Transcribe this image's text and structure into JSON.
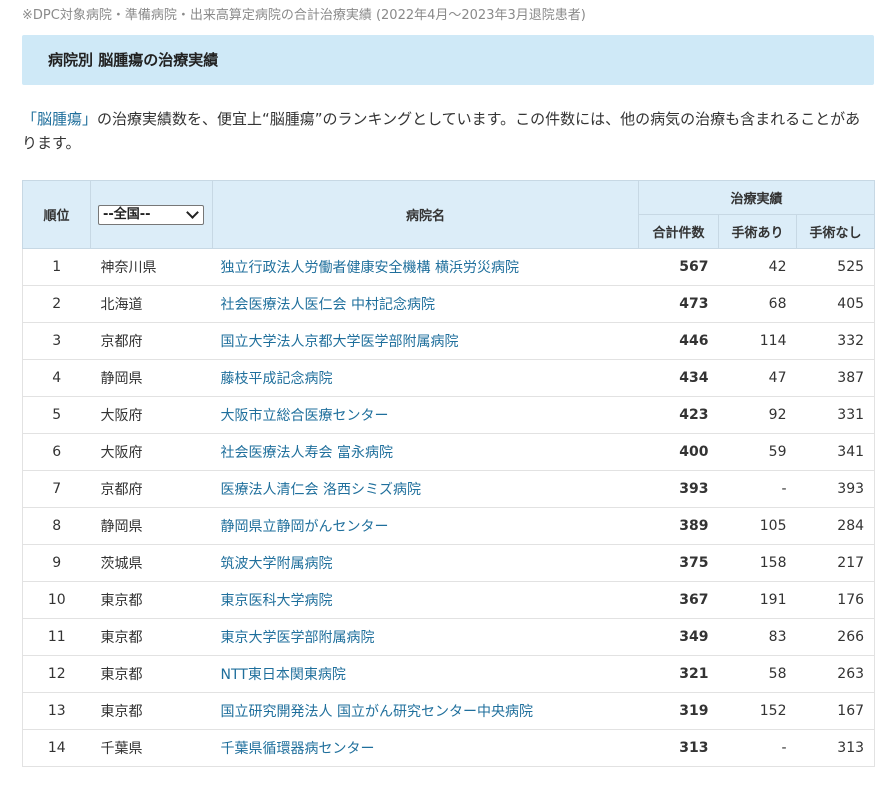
{
  "note": "※DPC対象病院・準備病院・出来高算定病院の合計治療実績 (2022年4月～2023年3月退院患者)",
  "banner": {
    "title": "病院別 脳腫瘍の治療実績"
  },
  "description": {
    "part1": "「脳腫瘍」",
    "part2": "の治療実績数を、便宜上“脳腫瘍”のランキングとしています。この件数には、他の病気の治療も含まれることがあります。"
  },
  "table": {
    "headers": {
      "rank": "順位",
      "region_select": "--全国--",
      "hospital": "病院名",
      "results": "治療実績",
      "total": "合計件数",
      "with_surgery": "手術あり",
      "without_surgery": "手術なし"
    },
    "rows": [
      {
        "rank": "1",
        "pref": "神奈川県",
        "name": "独立行政法人労働者健康安全機構 横浜労災病院",
        "total": "567",
        "with": "42",
        "without": "525"
      },
      {
        "rank": "2",
        "pref": "北海道",
        "name": "社会医療法人医仁会 中村記念病院",
        "total": "473",
        "with": "68",
        "without": "405"
      },
      {
        "rank": "3",
        "pref": "京都府",
        "name": "国立大学法人京都大学医学部附属病院",
        "total": "446",
        "with": "114",
        "without": "332"
      },
      {
        "rank": "4",
        "pref": "静岡県",
        "name": "藤枝平成記念病院",
        "total": "434",
        "with": "47",
        "without": "387"
      },
      {
        "rank": "5",
        "pref": "大阪府",
        "name": "大阪市立総合医療センター",
        "total": "423",
        "with": "92",
        "without": "331"
      },
      {
        "rank": "6",
        "pref": "大阪府",
        "name": "社会医療法人寿会 富永病院",
        "total": "400",
        "with": "59",
        "without": "341"
      },
      {
        "rank": "7",
        "pref": "京都府",
        "name": "医療法人清仁会 洛西シミズ病院",
        "total": "393",
        "with": "-",
        "without": "393"
      },
      {
        "rank": "8",
        "pref": "静岡県",
        "name": "静岡県立静岡がんセンター",
        "total": "389",
        "with": "105",
        "without": "284"
      },
      {
        "rank": "9",
        "pref": "茨城県",
        "name": "筑波大学附属病院",
        "total": "375",
        "with": "158",
        "without": "217"
      },
      {
        "rank": "10",
        "pref": "東京都",
        "name": "東京医科大学病院",
        "total": "367",
        "with": "191",
        "without": "176"
      },
      {
        "rank": "11",
        "pref": "東京都",
        "name": "東京大学医学部附属病院",
        "total": "349",
        "with": "83",
        "without": "266"
      },
      {
        "rank": "12",
        "pref": "東京都",
        "name": "NTT東日本関東病院",
        "total": "321",
        "with": "58",
        "without": "263"
      },
      {
        "rank": "13",
        "pref": "東京都",
        "name": "国立研究開発法人 国立がん研究センター中央病院",
        "total": "319",
        "with": "152",
        "without": "167"
      },
      {
        "rank": "14",
        "pref": "千葉県",
        "name": "千葉県循環器病センター",
        "total": "313",
        "with": "-",
        "without": "313"
      }
    ]
  }
}
